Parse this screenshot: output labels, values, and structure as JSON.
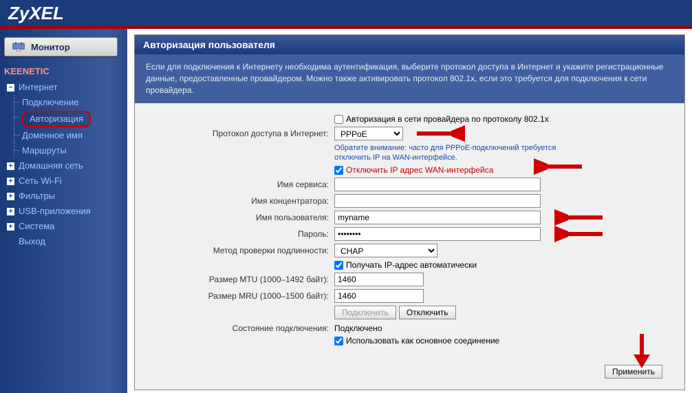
{
  "brand": "ZyXEL",
  "sidebar": {
    "monitor": "Монитор",
    "root": "KEENETIC",
    "items": [
      {
        "label": "Интернет",
        "expanded": true,
        "children": [
          {
            "label": "Подключение"
          },
          {
            "label": "Авторизация",
            "active": true
          },
          {
            "label": "Доменное имя"
          },
          {
            "label": "Маршруты"
          }
        ]
      },
      {
        "label": "Домашняя сеть",
        "expanded": false
      },
      {
        "label": "Сеть Wi-Fi",
        "expanded": false
      },
      {
        "label": "Фильтры",
        "expanded": false
      },
      {
        "label": "USB-приложения",
        "expanded": false
      },
      {
        "label": "Система",
        "expanded": false
      },
      {
        "label": "Выход",
        "leaf": true
      }
    ]
  },
  "panel": {
    "title": "Авторизация пользователя",
    "desc": "Если для подключения к Интернету необходима аутентификация, выберите протокол доступа в Интернет и укажите регистрационные данные, предоставленные провайдером. Можно также активировать протокол 802.1x, если это требуется для подключения к сети провайдера."
  },
  "form": {
    "auth8021x_label": "Авторизация в сети провайдера по протоколу 802.1x",
    "auth8021x_checked": false,
    "protocol_label": "Протокол доступа в Интернет:",
    "protocol_value": "PPPoE",
    "protocol_options": [
      "PPPoE"
    ],
    "hint": "Обратите внимание: часто для PPPoE-подключений требуется отключить IP на WAN-интерфейсе.",
    "disable_wan_label": "Отключить IP адрес WAN-интерфейса",
    "disable_wan_checked": true,
    "service_label": "Имя сервиса:",
    "service_value": "",
    "concentrator_label": "Имя концентратора:",
    "concentrator_value": "",
    "username_label": "Имя пользователя:",
    "username_value": "myname",
    "password_label": "Пароль:",
    "password_value": "••••••••",
    "authmethod_label": "Метод проверки подлинности:",
    "authmethod_value": "CHAP",
    "authmethod_options": [
      "CHAP"
    ],
    "autoip_label": "Получать IP-адрес автоматически",
    "autoip_checked": true,
    "mtu_label": "Размер MTU (1000–1492 байт):",
    "mtu_value": "1460",
    "mru_label": "Размер MRU (1000–1500 байт):",
    "mru_value": "1460",
    "connect_btn": "Подключить",
    "disconnect_btn": "Отключить",
    "status_label": "Состояние подключения:",
    "status_value": "Подключено",
    "default_conn_label": "Использовать как основное соединение",
    "default_conn_checked": true,
    "apply_btn": "Применить"
  }
}
